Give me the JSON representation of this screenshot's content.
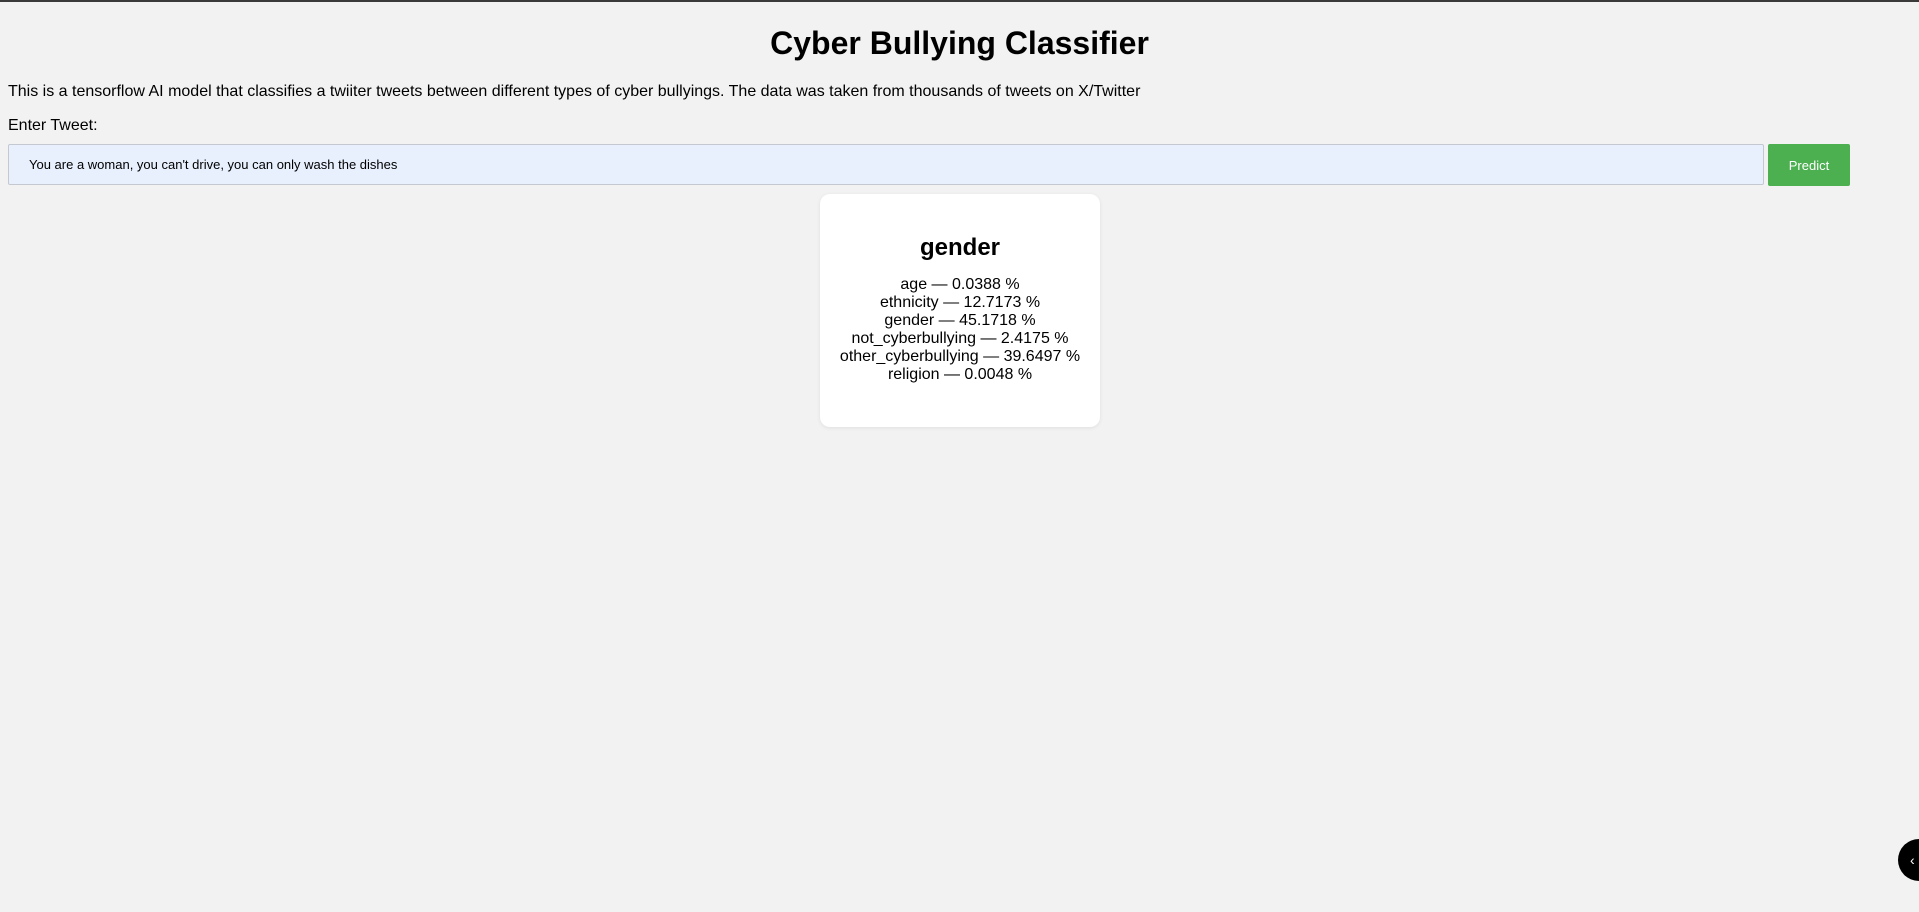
{
  "header": {
    "title": "Cyber Bullying Classifier"
  },
  "intro": {
    "description": "This is a tensorflow AI model that classifies a twiiter tweets between different types of cyber bullyings. The data was taken from thousands of tweets on X/Twitter"
  },
  "form": {
    "label": "Enter Tweet:",
    "tweet_value": "You are a woman, you can't drive, you can only wash the dishes",
    "tweet_placeholder": "",
    "predict_label": "Predict"
  },
  "result": {
    "predicted_label": "gender",
    "probabilities": [
      {
        "text": "age — 0.0388 %"
      },
      {
        "text": "ethnicity — 12.7173 %"
      },
      {
        "text": "gender — 45.1718 %"
      },
      {
        "text": "not_cyberbullying — 2.4175 %"
      },
      {
        "text": "other_cyberbullying — 39.6497 %"
      },
      {
        "text": "religion — 0.0048 %"
      }
    ]
  },
  "widgets": {
    "chat_icon": "chevron-left-icon"
  },
  "colors": {
    "background": "#f2f2f2",
    "button": "#4caf50",
    "input_background": "#e8f0fe"
  }
}
